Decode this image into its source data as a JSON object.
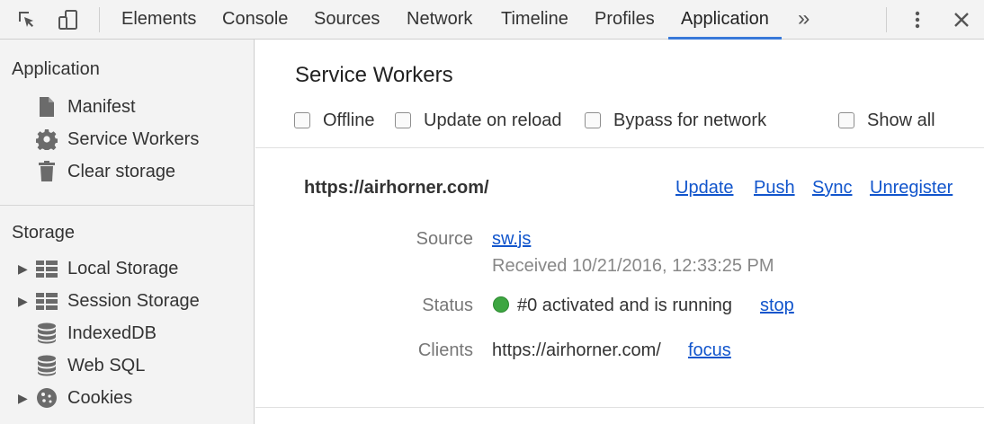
{
  "toolbar": {
    "tabs": [
      "Elements",
      "Console",
      "Sources",
      "Network",
      "Timeline",
      "Profiles",
      "Application"
    ],
    "active_tab": "Application",
    "overflow": "»"
  },
  "sidebar": {
    "application": {
      "title": "Application",
      "items": [
        "Manifest",
        "Service Workers",
        "Clear storage"
      ]
    },
    "storage": {
      "title": "Storage",
      "items": [
        "Local Storage",
        "Session Storage",
        "IndexedDB",
        "Web SQL",
        "Cookies"
      ]
    }
  },
  "main": {
    "title": "Service Workers",
    "checkboxes": [
      "Offline",
      "Update on reload",
      "Bypass for network",
      "Show all"
    ],
    "worker": {
      "origin": "https://airhorner.com/",
      "actions": [
        "Update",
        "Push",
        "Sync",
        "Unregister"
      ],
      "source_label": "Source",
      "source_file": "sw.js",
      "received": "Received 10/21/2016, 12:33:25 PM",
      "status_label": "Status",
      "status_text": "#0 activated and is running",
      "status_action": "stop",
      "status_color": "#3da641",
      "clients_label": "Clients",
      "client_url": "https://airhorner.com/",
      "client_action": "focus"
    }
  },
  "colors": {
    "accent": "#3879d9",
    "link": "#1155cc"
  }
}
